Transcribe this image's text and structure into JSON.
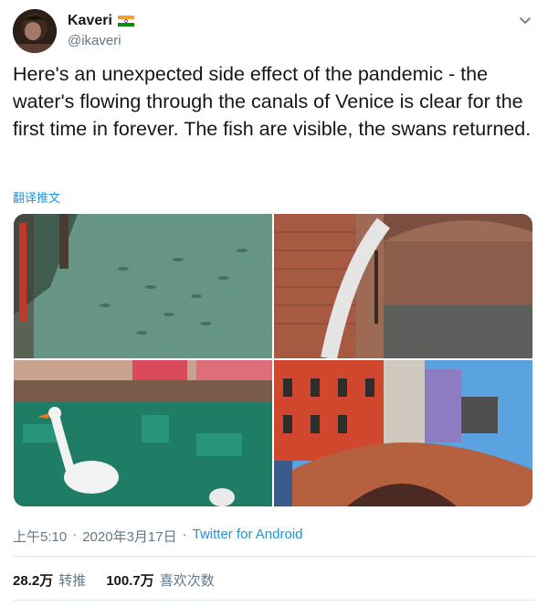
{
  "author": {
    "name": "Kaveri",
    "handle": "@ikaveri"
  },
  "tweet": {
    "text": "Here's an unexpected side effect of the pandemic - the water's flowing through the canals of Venice is clear for the first time in forever. The fish are visible, the swans returned.",
    "translate_label": "翻译推文"
  },
  "meta": {
    "time": "上午5:10",
    "sep1": "·",
    "date": "2020年3月17日",
    "sep2": "·",
    "source": "Twitter for Android"
  },
  "stats": {
    "retweets_count": "28.2万",
    "retweets_label": "转推",
    "likes_count": "100.7万",
    "likes_label": "喜欢次数"
  },
  "colors": {
    "link": "#1b95e0",
    "secondary_text": "#657786",
    "divider": "#e1e8ed"
  },
  "icons": {
    "menu": "chevron-down-icon",
    "flag": "india-flag-icon"
  }
}
